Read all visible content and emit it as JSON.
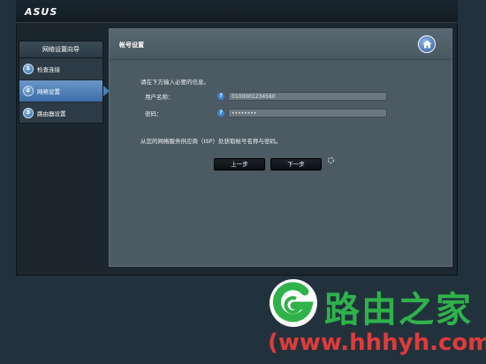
{
  "header": {
    "brand": "ASUS"
  },
  "wizard": {
    "title": "网络设置向导",
    "steps": [
      {
        "num": "1",
        "label": "检查连接"
      },
      {
        "num": "2",
        "label": "网络设置"
      },
      {
        "num": "3",
        "label": "路由器设置"
      }
    ],
    "active_step": 2
  },
  "main": {
    "title": "帐号设置",
    "instruction": "请在下方输入必要的信息。",
    "username": {
      "label": "用户名称：",
      "help": "?",
      "value": "0100001234560"
    },
    "password": {
      "label": "密码：",
      "help": "?",
      "value": "••••••••"
    },
    "isp_note": "从您的网络服务供应商（ISP）处获取帐号名称与密码。",
    "prev_label": "上一步",
    "next_label": "下一步"
  },
  "watermark": {
    "text": "路由之家",
    "url": "(www.hhhyh.com)"
  },
  "colors": {
    "accent": "#4f7fb8",
    "panel": "#4c5a63",
    "watermark_green": "#2fb24a",
    "watermark_red": "#e23a3a"
  }
}
